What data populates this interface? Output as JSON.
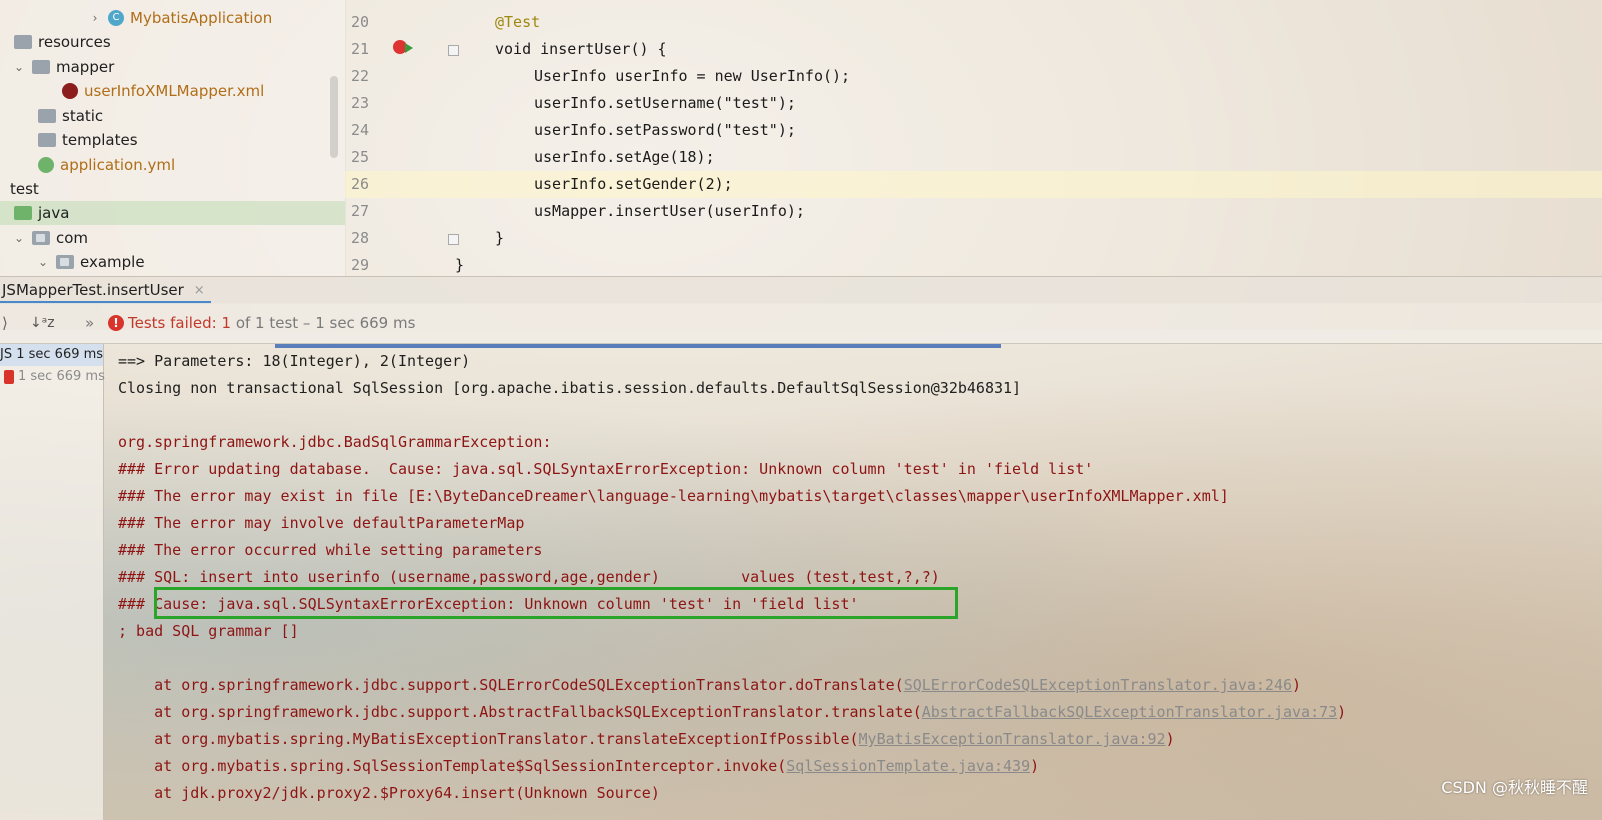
{
  "project_tree": {
    "items": [
      {
        "label": "MybatisApplication",
        "icon": "class-icon"
      },
      {
        "label": "resources",
        "icon": "folder-icon"
      },
      {
        "label": "mapper",
        "icon": "folder-icon"
      },
      {
        "label": "userInfoXMLMapper.xml",
        "icon": "mybatis-xml-icon"
      },
      {
        "label": "static",
        "icon": "folder-icon"
      },
      {
        "label": "templates",
        "icon": "folder-icon"
      },
      {
        "label": "application.yml",
        "icon": "spring-yml-icon"
      },
      {
        "label": "test",
        "icon": ""
      },
      {
        "label": "java",
        "icon": "folder-icon"
      },
      {
        "label": "com",
        "icon": "package-icon"
      },
      {
        "label": "example",
        "icon": "package-icon"
      }
    ]
  },
  "editor": {
    "lines": [
      {
        "num": "20",
        "text": "@Test"
      },
      {
        "num": "21",
        "text": "void insertUser() {"
      },
      {
        "num": "22",
        "text": "UserInfo userInfo = new UserInfo();"
      },
      {
        "num": "23",
        "text": "userInfo.setUsername(\"test\");"
      },
      {
        "num": "24",
        "text": "userInfo.setPassword(\"test\");"
      },
      {
        "num": "25",
        "text": "userInfo.setAge(18);"
      },
      {
        "num": "26",
        "text": "userInfo.setGender(2);"
      },
      {
        "num": "27",
        "text": "usMapper.insertUser(userInfo);"
      },
      {
        "num": "28",
        "text": "}"
      },
      {
        "num": "29",
        "text": "}"
      }
    ]
  },
  "run_tab": {
    "label": "JSMapperTest.insertUser",
    "close": "×"
  },
  "toolbar": {
    "failed_label": "Tests failed: 1",
    "failed_detail": " of 1 test – 1 sec 669 ms",
    "more": "»"
  },
  "test_list": {
    "items": [
      {
        "label": "JS 1 sec 669 ms"
      },
      {
        "label": "1 sec 669 ms"
      }
    ]
  },
  "console": {
    "lines": [
      "==> Parameters: 18(Integer), 2(Integer)",
      "Closing non transactional SqlSession [org.apache.ibatis.session.defaults.DefaultSqlSession@32b46831]",
      "",
      "org.springframework.jdbc.BadSqlGrammarException:",
      "### Error updating database.  Cause: java.sql.SQLSyntaxErrorException: Unknown column 'test' in 'field list'",
      "### The error may exist in file [E:\\ByteDanceDreamer\\language-learning\\mybatis\\target\\classes\\mapper\\userInfoXMLMapper.xml]",
      "### The error may involve defaultParameterMap",
      "### The error occurred while setting parameters",
      "### SQL: insert into userinfo (username,password,age,gender)         values (test,test,?,?)",
      "### Cause: java.sql.SQLSyntaxErrorException: Unknown column 'test' in 'field list'",
      "; bad SQL grammar []"
    ],
    "stack": [
      {
        "prefix": "    at org.springframework.jdbc.support.SQLErrorCodeSQLExceptionTranslator.doTranslate(",
        "link": "SQLErrorCodeSQLExceptionTranslator.java:246",
        "suffix": ")"
      },
      {
        "prefix": "    at org.springframework.jdbc.support.AbstractFallbackSQLExceptionTranslator.translate(",
        "link": "AbstractFallbackSQLExceptionTranslator.java:73",
        "suffix": ")"
      },
      {
        "prefix": "    at org.mybatis.spring.MyBatisExceptionTranslator.translateExceptionIfPossible(",
        "link": "MyBatisExceptionTranslator.java:92",
        "suffix": ")"
      },
      {
        "prefix": "    at org.mybatis.spring.SqlSessionTemplate$SqlSessionInterceptor.invoke(",
        "link": "SqlSessionTemplate.java:439",
        "suffix": ")"
      },
      {
        "prefix": "    at jdk.proxy2/jdk.proxy2.$Proxy64.insert(Unknown Source)",
        "link": "",
        "suffix": ""
      }
    ]
  },
  "watermark": "CSDN @秋秋睡不醒",
  "colors": {
    "error_red": "#8e1414",
    "highlight_green": "#2aa52a",
    "tab_blue": "#4a88c7"
  }
}
